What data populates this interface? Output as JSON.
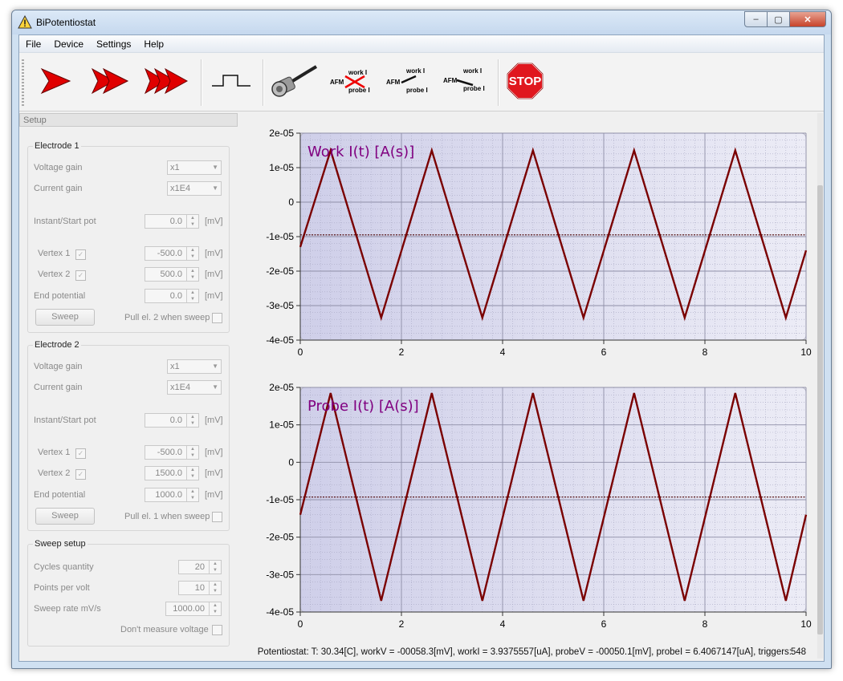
{
  "window": {
    "title": "BiPotentiostat",
    "minimize": "–",
    "maximize": "▢",
    "close": "✕"
  },
  "menu": [
    "File",
    "Device",
    "Settings",
    "Help"
  ],
  "toolbar": {
    "buttons": [
      "play-single",
      "play-double",
      "play-triple",
      "pulse",
      "bnc-cable",
      "afm-disconnected",
      "afm-work",
      "afm-probe",
      "stop"
    ],
    "afm_label": "AFM",
    "work_label": "work I",
    "probe_label": "probe I",
    "stop_label": "STOP"
  },
  "setup_tab": "Setup",
  "electrode1": {
    "title": "Electrode 1",
    "voltage_gain_label": "Voltage gain",
    "voltage_gain": "x1",
    "current_gain_label": "Current gain",
    "current_gain": "x1E4",
    "start_pot_label": "Instant/Start pot",
    "start_pot": "0.0",
    "unit": "[mV]",
    "vertex1_label": "Vertex 1",
    "vertex1": "-500.0",
    "vertex2_label": "Vertex 2",
    "vertex2": "500.0",
    "end_label": "End potential",
    "end": "0.0",
    "sweep_button": "Sweep",
    "pull_label": "Pull el. 2 when sweep"
  },
  "electrode2": {
    "title": "Electrode 2",
    "voltage_gain_label": "Voltage gain",
    "voltage_gain": "x1",
    "current_gain_label": "Current gain",
    "current_gain": "x1E4",
    "start_pot_label": "Instant/Start pot",
    "start_pot": "0.0",
    "unit": "[mV]",
    "vertex1_label": "Vertex 1",
    "vertex1": "-500.0",
    "vertex2_label": "Vertex 2",
    "vertex2": "1500.0",
    "end_label": "End potential",
    "end": "1000.0",
    "sweep_button": "Sweep",
    "pull_label": "Pull el. 1 when sweep"
  },
  "sweep_setup": {
    "title": "Sweep setup",
    "cycles_label": "Cycles quantity",
    "cycles": "20",
    "points_label": "Points per volt",
    "points": "10",
    "rate_label": "Sweep rate mV/s",
    "rate": "1000.00",
    "no_voltage_label": "Don't measure voltage"
  },
  "status": {
    "text": "Potentiostat: T: 30.34[C], workV = -00058.3[mV], workI = 3.9375557[uA], probeV = -00050.1[mV], probeI = 6.4067147[uA], triggers:",
    "triggers": "548"
  },
  "colors": {
    "curve": "#7a0000",
    "plot_bg": "#d8d8ef",
    "title": "#800080"
  },
  "chart_data": [
    {
      "type": "line",
      "title": "Work I(t) [A(s)]",
      "xlim": [
        0,
        10
      ],
      "ylim": [
        -4e-05,
        2e-05
      ],
      "xticks": [
        "0",
        "2",
        "4",
        "6",
        "8",
        "10"
      ],
      "yticks": [
        "2e-05",
        "1e-05",
        "0",
        "-1e-05",
        "-2e-05",
        "-3e-05",
        "-4e-05"
      ],
      "grid": true,
      "series": [
        {
          "x": [
            0,
            0.6,
            1.6,
            2.6,
            3.6,
            4.6,
            5.6,
            6.6,
            7.6,
            8.6,
            9.6,
            10
          ],
          "y": [
            -1.3e-05,
            1.5e-05,
            -3.35e-05,
            1.5e-05,
            -3.35e-05,
            1.5e-05,
            -3.35e-05,
            1.5e-05,
            -3.35e-05,
            1.5e-05,
            -3.35e-05,
            -1.4e-05
          ]
        },
        {
          "x": [
            0,
            10
          ],
          "y": [
            -9.5e-06,
            -9.5e-06
          ]
        }
      ]
    },
    {
      "type": "line",
      "title": "Probe I(t) [A(s)]",
      "xlim": [
        0,
        10
      ],
      "ylim": [
        -4e-05,
        2e-05
      ],
      "xticks": [
        "0",
        "2",
        "4",
        "6",
        "8",
        "10"
      ],
      "yticks": [
        "2e-05",
        "1e-05",
        "0",
        "-1e-05",
        "-2e-05",
        "-3e-05",
        "-4e-05"
      ],
      "grid": true,
      "series": [
        {
          "x": [
            0,
            0.6,
            1.6,
            2.6,
            3.6,
            4.6,
            5.6,
            6.6,
            7.6,
            8.6,
            9.6,
            10
          ],
          "y": [
            -1.4e-05,
            1.85e-05,
            -3.7e-05,
            1.85e-05,
            -3.7e-05,
            1.85e-05,
            -3.7e-05,
            1.85e-05,
            -3.7e-05,
            1.85e-05,
            -3.7e-05,
            -1.4e-05
          ]
        },
        {
          "x": [
            0,
            10
          ],
          "y": [
            -9.3e-06,
            -9.3e-06
          ]
        }
      ]
    }
  ]
}
